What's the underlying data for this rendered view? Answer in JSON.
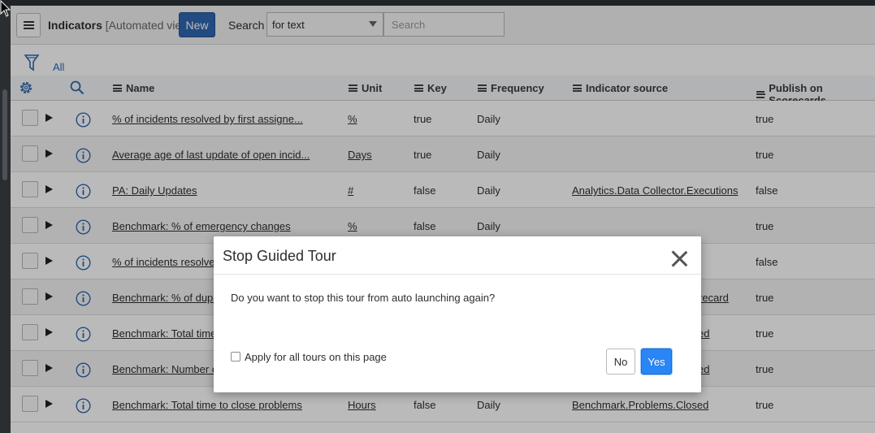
{
  "header": {
    "title": "Indicators",
    "view_label": "[Automated view]",
    "new_button": "New",
    "search_label": "Search",
    "search_field_selected": "for text",
    "search_placeholder": "Search"
  },
  "filter": {
    "all_label": "All"
  },
  "columns": {
    "name": "Name",
    "unit": "Unit",
    "key": "Key",
    "frequency": "Frequency",
    "indicator_source": "Indicator source",
    "publish": "Publish on Scorecards"
  },
  "rows": [
    {
      "name": "% of incidents resolved by first assigne...",
      "unit": "%",
      "key": "true",
      "frequency": "Daily",
      "source": "",
      "publish": "true"
    },
    {
      "name": "Average age of last update of open incid...",
      "unit": "Days",
      "key": "true",
      "frequency": "Daily",
      "source": "",
      "publish": "true"
    },
    {
      "name": "PA: Daily Updates",
      "unit": "#",
      "key": "false",
      "frequency": "Daily",
      "source": "Analytics.Data Collector.Executions",
      "publish": "false"
    },
    {
      "name": "Benchmark: % of emergency changes",
      "unit": "%",
      "key": "false",
      "frequency": "Daily",
      "source": "",
      "publish": "true"
    },
    {
      "name": "% of incidents resolved",
      "unit": "",
      "key": "",
      "frequency": "",
      "source": "",
      "publish": "false"
    },
    {
      "name": "Benchmark: % of dupli",
      "unit": "",
      "key": "",
      "frequency": "",
      "source": "recard",
      "publish": "true"
    },
    {
      "name": "Benchmark: Total time",
      "unit": "",
      "key": "",
      "frequency": "",
      "source": "ed",
      "publish": "true"
    },
    {
      "name": "Benchmark: Number of",
      "unit": "",
      "key": "",
      "frequency": "",
      "source": "ed",
      "publish": "true"
    },
    {
      "name": "Benchmark: Total time to close problems",
      "unit": "Hours",
      "key": "false",
      "frequency": "Daily",
      "source": "Benchmark.Problems.Closed",
      "publish": "true"
    }
  ],
  "modal": {
    "title": "Stop Guided Tour",
    "message": "Do you want to stop this tour from auto launching again?",
    "checkbox_label": "Apply for all tours on this page",
    "no_button": "No",
    "yes_button": "Yes"
  }
}
